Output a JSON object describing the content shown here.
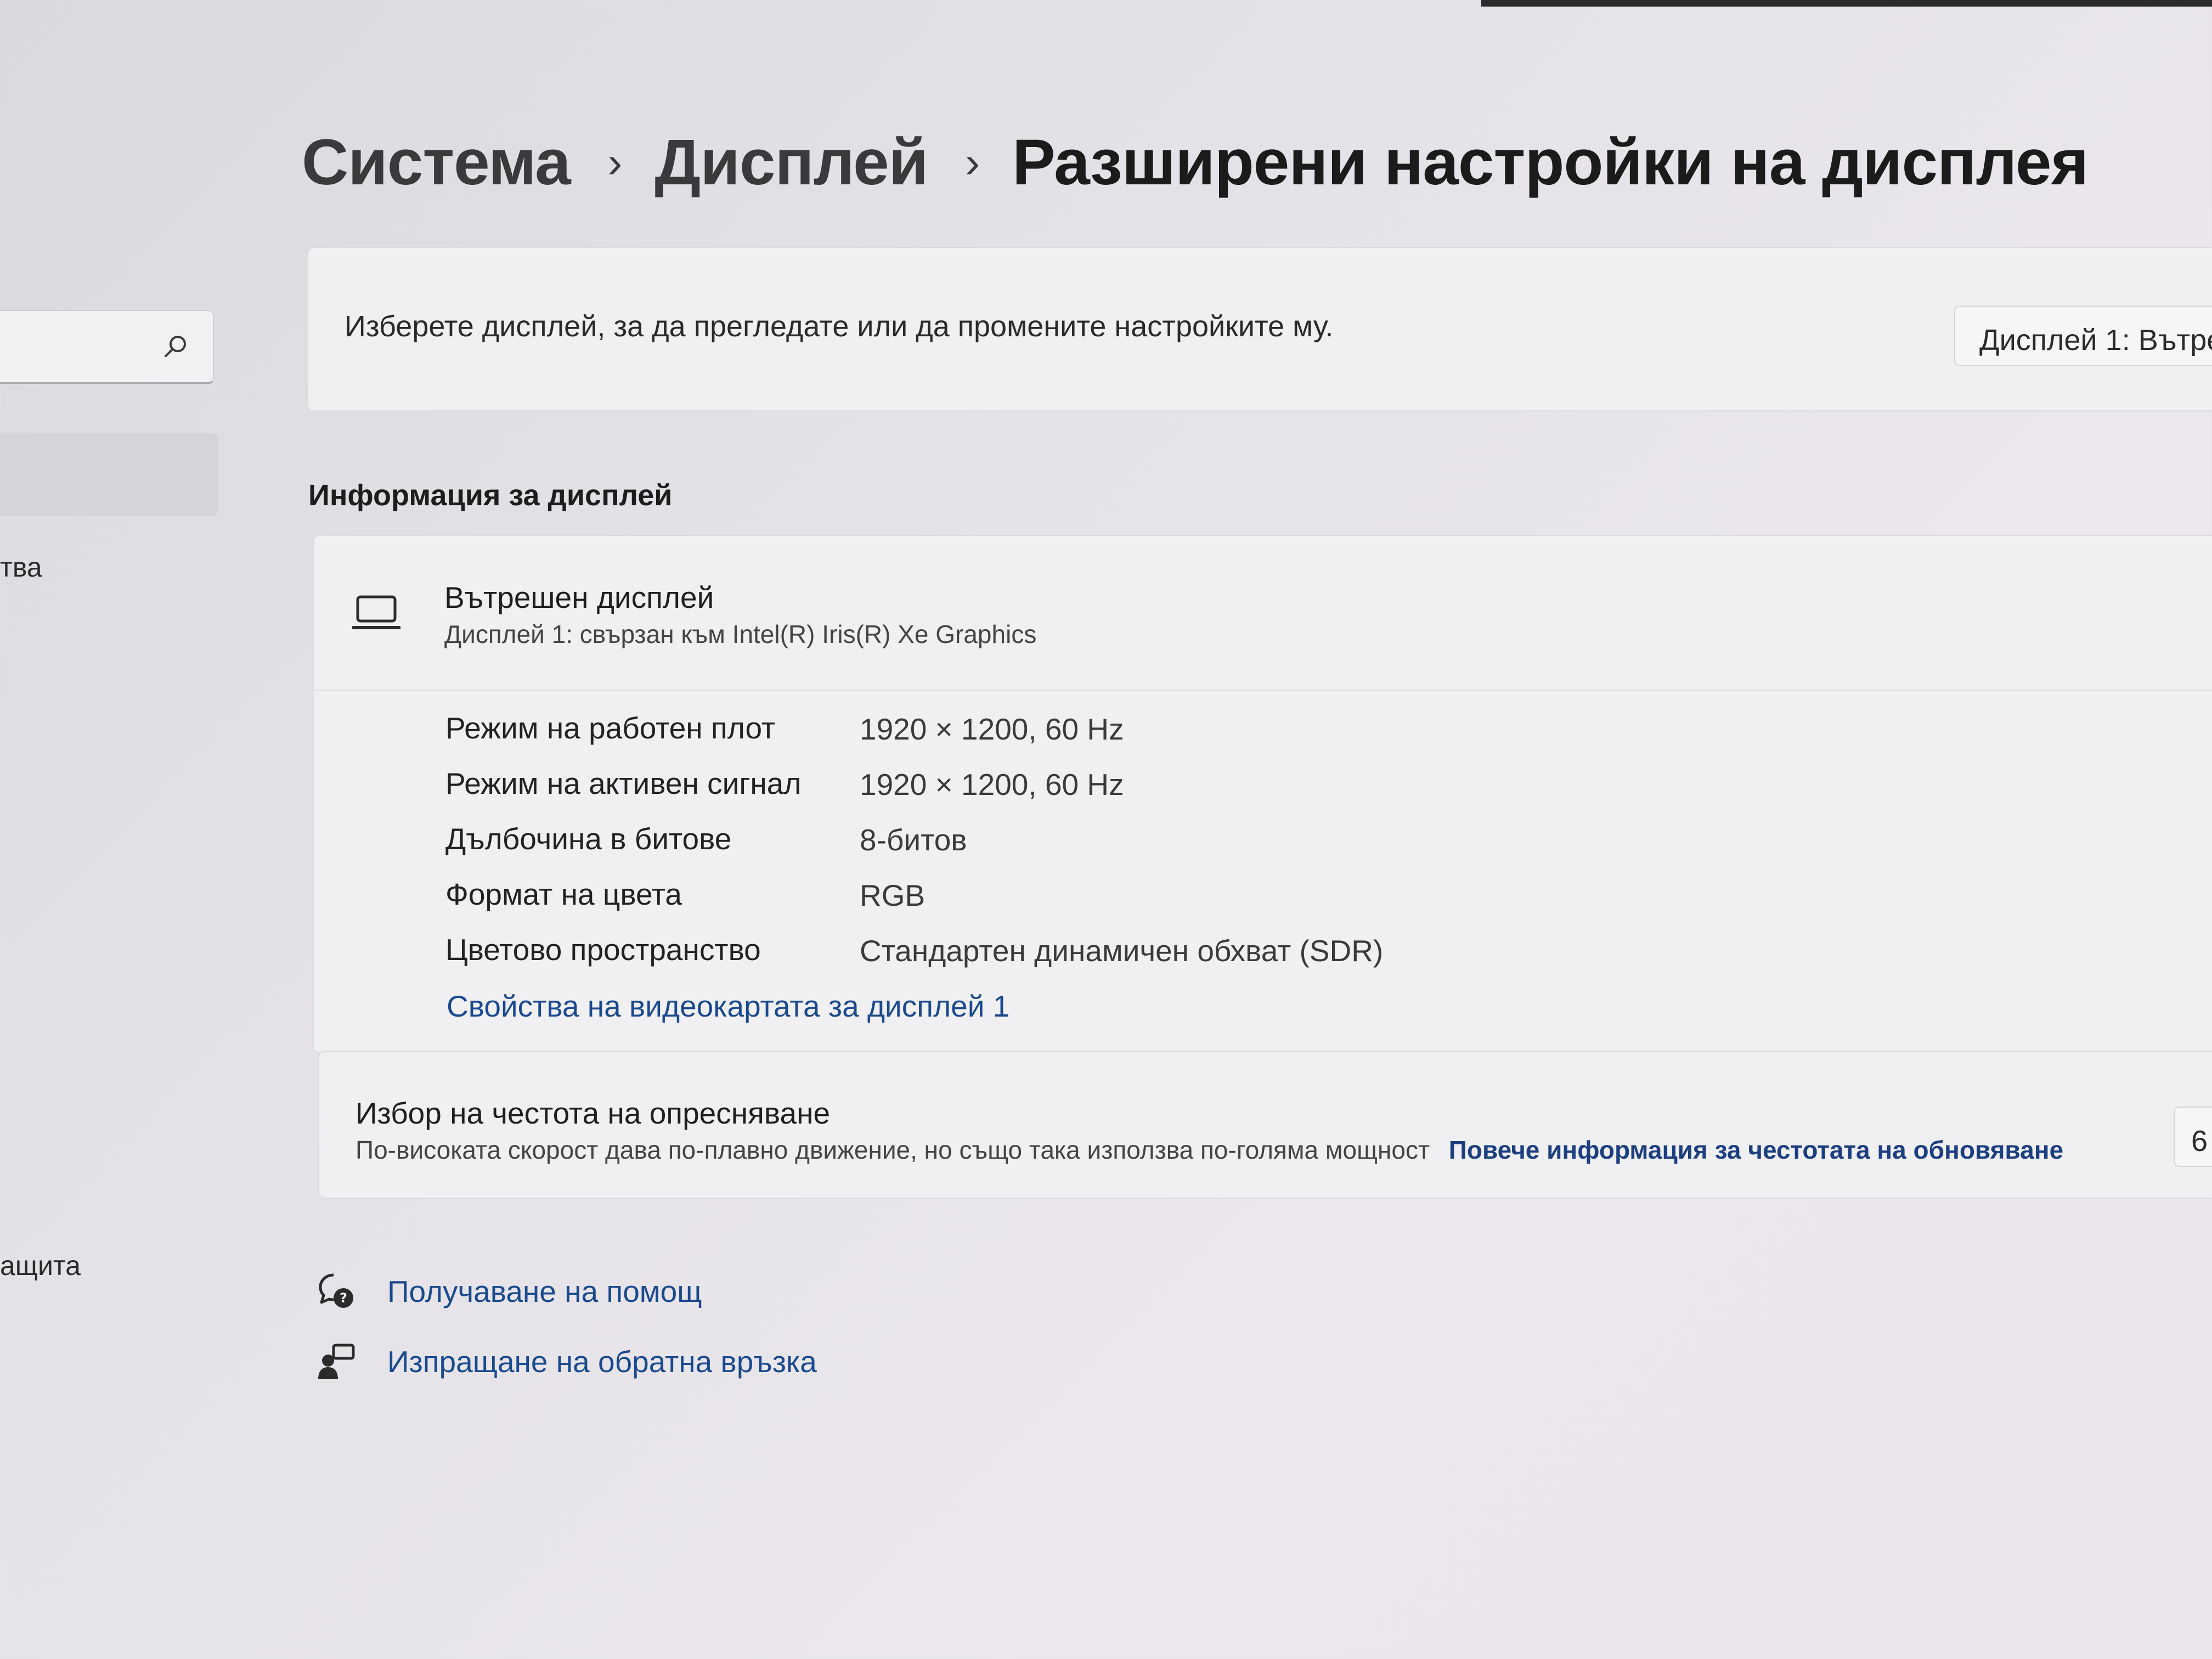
{
  "sidebar": {
    "search_icon": "search-icon",
    "items": [
      {
        "label": "тва"
      },
      {
        "label": "ащита"
      }
    ]
  },
  "breadcrumb": {
    "items": [
      "Система",
      "Дисплей"
    ],
    "separator": "›",
    "current": "Разширени настройки на дисплея"
  },
  "select_display": {
    "text": "Изберете дисплей, за да прегледате или да промените настройките му.",
    "dropdown_value": "Дисплей 1: Вътре"
  },
  "display_info": {
    "section_title": "Информация за дисплей",
    "icon": "laptop-icon",
    "name": "Вътрешен дисплей",
    "subtitle": "Дисплей 1: свързан към Intel(R) Iris(R) Xe Graphics",
    "properties": [
      {
        "label": "Режим на работен плот",
        "value": "1920 × 1200, 60 Hz"
      },
      {
        "label": "Режим на активен сигнал",
        "value": "1920 × 1200, 60 Hz"
      },
      {
        "label": "Дълбочина в битове",
        "value": "8-битов"
      },
      {
        "label": "Формат на цвета",
        "value": "RGB"
      },
      {
        "label": "Цветово пространство",
        "value": "Стандартен динамичен обхват (SDR)"
      }
    ],
    "adapter_link": "Свойства на видеокартата за дисплей 1"
  },
  "refresh_rate": {
    "title": "Избор на честота на опресняване",
    "description": "По-високата скорост дава по-плавно движение, но също така използва по-голяма мощност",
    "link": "Повече информация за честотата на обновяване",
    "dropdown_value": "6"
  },
  "footer": {
    "help": {
      "label": "Получаване на помощ",
      "icon": "help-icon"
    },
    "feedback": {
      "label": "Изпращане на обратна връзка",
      "icon": "feedback-icon"
    }
  },
  "colors": {
    "link": "#1a4a8e",
    "card_background": "#f0eff2",
    "page_background": "#e4e2e7"
  }
}
